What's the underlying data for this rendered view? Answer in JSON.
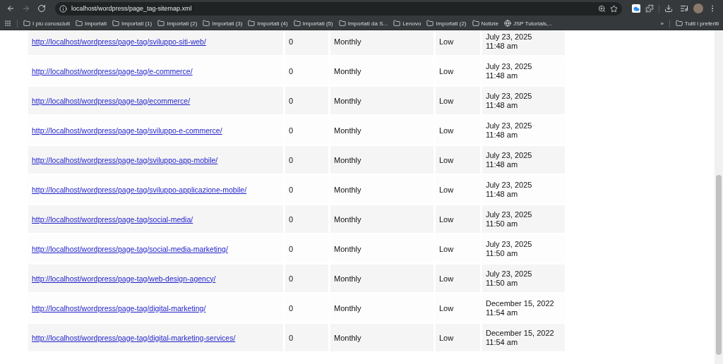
{
  "browser": {
    "url": "localhost/wordpress/page_tag-sitemap.xml",
    "bookmarks": [
      {
        "label": "I più conosciuti",
        "kind": "folder"
      },
      {
        "label": "Importati",
        "kind": "folder"
      },
      {
        "label": "Importati (1)",
        "kind": "folder"
      },
      {
        "label": "Importati (2)",
        "kind": "folder"
      },
      {
        "label": "Importati (3)",
        "kind": "folder"
      },
      {
        "label": "Importati (4)",
        "kind": "folder"
      },
      {
        "label": "Importati (5)",
        "kind": "folder"
      },
      {
        "label": "Importati da S...",
        "kind": "folder"
      },
      {
        "label": "Lenovo",
        "kind": "folder"
      },
      {
        "label": "Importati (2)",
        "kind": "folder"
      },
      {
        "label": "Notizie",
        "kind": "folder"
      },
      {
        "label": "JSP Tutorials,...",
        "kind": "site"
      }
    ],
    "overflow": "»",
    "all_bookmarks": "Tutti i preferiti"
  },
  "table": {
    "rows": [
      {
        "url": "http://localhost/wordpress/page-tag/sviluppo-siti-web/",
        "images": "0",
        "frequency": "Monthly",
        "priority": "Low",
        "date": "July 23, 2025",
        "time": "11:48 am"
      },
      {
        "url": "http://localhost/wordpress/page-tag/e-commerce/",
        "images": "0",
        "frequency": "Monthly",
        "priority": "Low",
        "date": "July 23, 2025",
        "time": "11:48 am"
      },
      {
        "url": "http://localhost/wordpress/page-tag/ecommerce/",
        "images": "0",
        "frequency": "Monthly",
        "priority": "Low",
        "date": "July 23, 2025",
        "time": "11:48 am"
      },
      {
        "url": "http://localhost/wordpress/page-tag/sviluppo-e-commerce/",
        "images": "0",
        "frequency": "Monthly",
        "priority": "Low",
        "date": "July 23, 2025",
        "time": "11:48 am"
      },
      {
        "url": "http://localhost/wordpress/page-tag/sviluppo-app-mobile/",
        "images": "0",
        "frequency": "Monthly",
        "priority": "Low",
        "date": "July 23, 2025",
        "time": "11:48 am"
      },
      {
        "url": "http://localhost/wordpress/page-tag/sviluppo-applicazione-mobile/",
        "images": "0",
        "frequency": "Monthly",
        "priority": "Low",
        "date": "July 23, 2025",
        "time": "11:48 am"
      },
      {
        "url": "http://localhost/wordpress/page-tag/social-media/",
        "images": "0",
        "frequency": "Monthly",
        "priority": "Low",
        "date": "July 23, 2025",
        "time": "11:50 am"
      },
      {
        "url": "http://localhost/wordpress/page-tag/social-media-marketing/",
        "images": "0",
        "frequency": "Monthly",
        "priority": "Low",
        "date": "July 23, 2025",
        "time": "11:50 am"
      },
      {
        "url": "http://localhost/wordpress/page-tag/web-design-agency/",
        "images": "0",
        "frequency": "Monthly",
        "priority": "Low",
        "date": "July 23, 2025",
        "time": "11:50 am"
      },
      {
        "url": "http://localhost/wordpress/page-tag/digital-marketing/",
        "images": "0",
        "frequency": "Monthly",
        "priority": "Low",
        "date": "December 15, 2022",
        "time": "11:54 am"
      },
      {
        "url": "http://localhost/wordpress/page-tag/digital-marketing-services/",
        "images": "0",
        "frequency": "Monthly",
        "priority": "Low",
        "date": "December 15, 2022",
        "time": "11:54 am"
      }
    ]
  }
}
